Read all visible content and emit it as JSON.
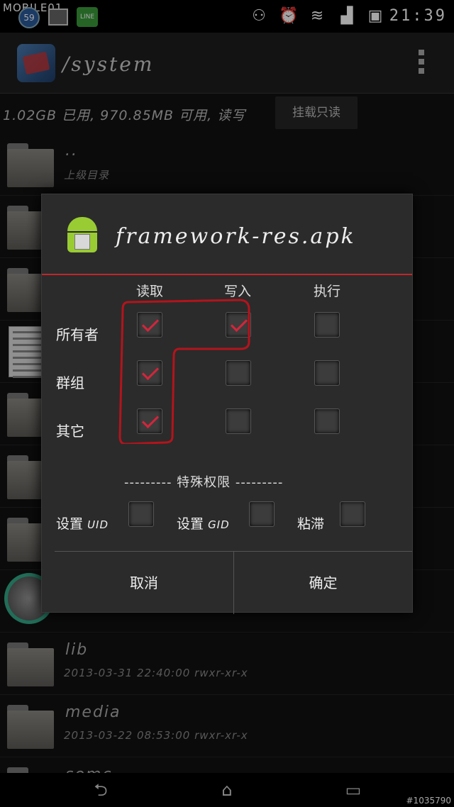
{
  "status_bar": {
    "brand": "MOBILE01",
    "notification_count": "59",
    "line_app": "LINE",
    "time": "21:39"
  },
  "action_bar": {
    "path": "/system"
  },
  "storage": {
    "info": "1.02GB 已用, 970.85MB 可用, 读写",
    "mount_button": "挂载只读"
  },
  "files": [
    {
      "name": "..",
      "meta": "上级目录"
    },
    {
      "name": "lib",
      "meta": "2013-03-31 22:40:00  rwxr-xr-x"
    },
    {
      "name": "media",
      "meta": "2013-03-22 08:53:00  rwxr-xr-x"
    },
    {
      "name": "semc",
      "meta": ""
    }
  ],
  "dialog": {
    "title": "framework-res.apk",
    "columns": [
      "读取",
      "写入",
      "执行"
    ],
    "rows": [
      {
        "label": "所有者",
        "read": true,
        "write": true,
        "execute": false
      },
      {
        "label": "群组",
        "read": true,
        "write": false,
        "execute": false
      },
      {
        "label": "其它",
        "read": true,
        "write": false,
        "execute": false
      }
    ],
    "special_header": "--------- 特殊权限 ---------",
    "special_options": [
      {
        "label": "设置",
        "code": "UID",
        "checked": false
      },
      {
        "label": "设置",
        "code": "GID",
        "checked": false
      },
      {
        "label": "粘滞",
        "code": "",
        "checked": false
      }
    ],
    "cancel": "取消",
    "confirm": "确定"
  },
  "watermark": "#1035790",
  "colors": {
    "accent": "#c2262a",
    "check": "#d4253b",
    "annotation": "#b3141c"
  }
}
